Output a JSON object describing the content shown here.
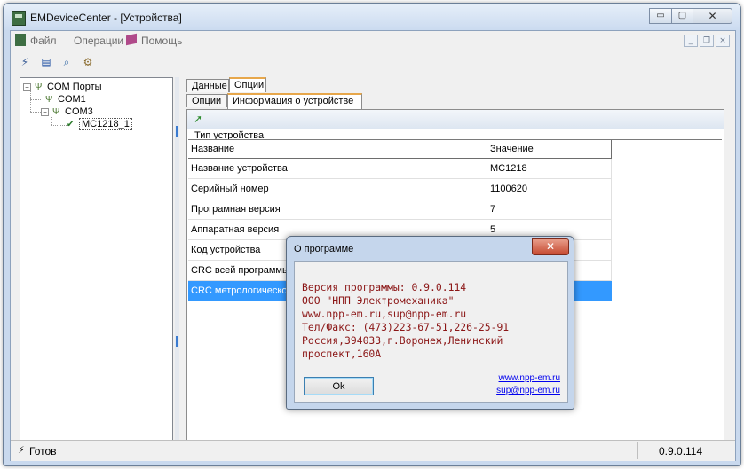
{
  "window": {
    "title": "EMDeviceCenter - [Устройства]",
    "minimize_label": "▭",
    "maximize_label": "▢",
    "close_label": "✕"
  },
  "menu": {
    "file": "Файл",
    "operations": "Операции",
    "help": "Помощь"
  },
  "mdi": {
    "minimize": "_",
    "restore": "❐",
    "close": "×"
  },
  "toolbar": {
    "icons": [
      "connect-icon",
      "settings-icon",
      "search-icon",
      "device-icon"
    ],
    "glyphs": [
      "⚡",
      "▤",
      "⌕",
      "⚙"
    ]
  },
  "tree": {
    "root": {
      "label": "COM Порты",
      "expander": "−"
    },
    "com1": {
      "label": "COM1"
    },
    "com3": {
      "label": "COM3",
      "expander": "−"
    },
    "device": {
      "label": "MC1218_1"
    }
  },
  "tabs": {
    "top": [
      "Данные",
      "Опции"
    ],
    "sub": [
      "Опции",
      "Информация о устройстве"
    ]
  },
  "panel": {
    "group_label": "Тип устройства",
    "columns": [
      "Название",
      "Значение"
    ],
    "rows": [
      [
        "Название устройства",
        "MC1218"
      ],
      [
        "Серийный номер",
        "1100620"
      ],
      [
        "Програмная версия",
        "7"
      ],
      [
        "Аппаратная версия",
        "5"
      ],
      [
        "Код устройства",
        ""
      ],
      [
        "CRC всей программы",
        ""
      ],
      [
        "CRC метрологической ч",
        ""
      ]
    ]
  },
  "status": {
    "text": "Готов",
    "version": "0.9.0.114"
  },
  "dialog": {
    "title": "О программе",
    "close_label": "✕",
    "body": "Версия программы: 0.9.0.114\nООО \"НПП Электромеханика\"\nwww.npp-em.ru,sup@npp-em.ru\nТел/Факс: (473)223-67-51,226-25-91\nРоссия,394033,г.Воронеж,Ленинский\nпроспект,160А",
    "ok_label": "Ok",
    "link_site": "www.npp-em.ru",
    "link_mail": "sup@npp-em.ru"
  },
  "colors": {
    "selection": "#3399ff",
    "dialog_text": "#8b1616",
    "title_bar": "#cbdbf0",
    "tab_accent": "#e7a74b"
  }
}
